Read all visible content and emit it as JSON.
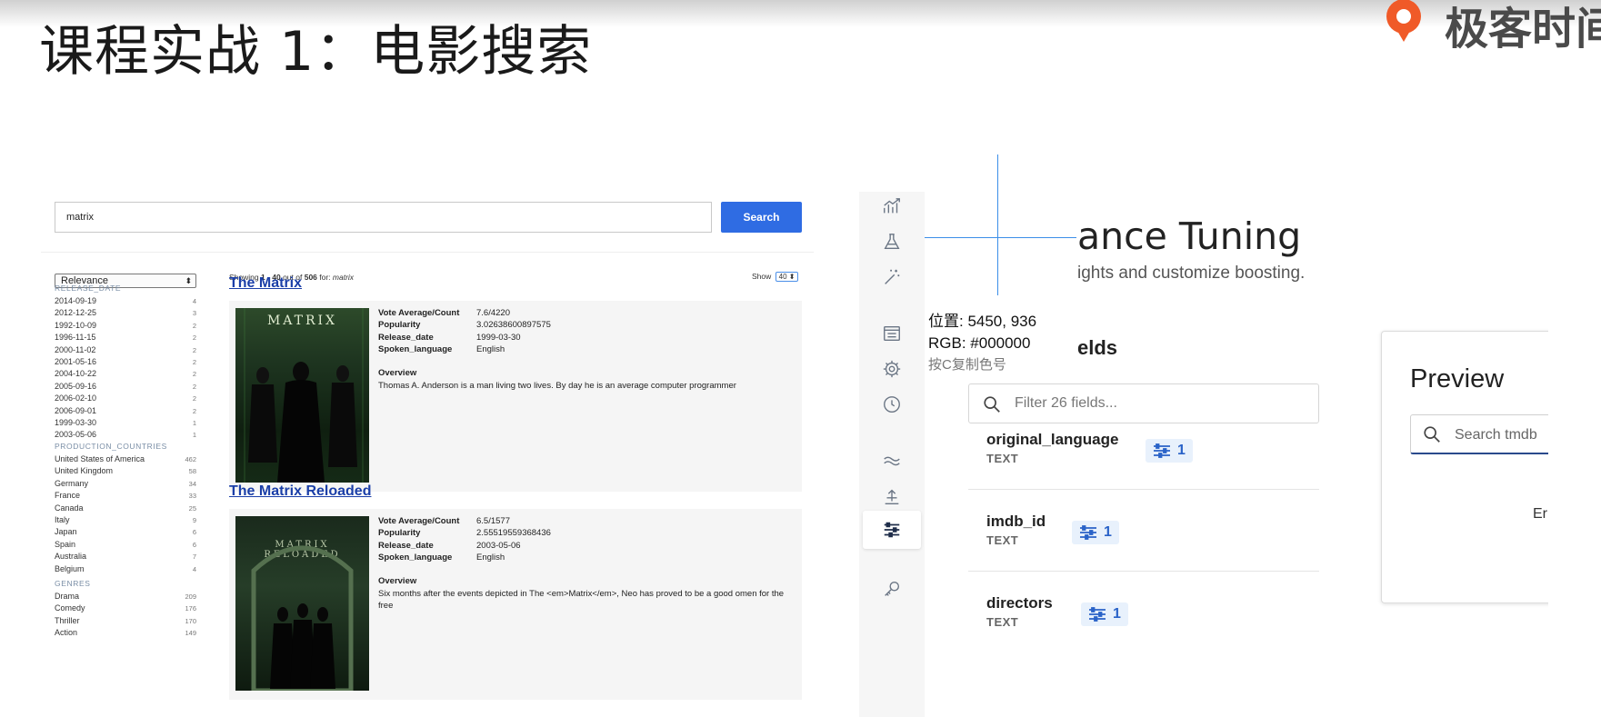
{
  "slide": {
    "title": "课程实战 1：电影搜索",
    "logo_text": "极客时间",
    "logo_color": "#f05a28"
  },
  "search_ui": {
    "query": "matrix",
    "search_label": "Search",
    "search_color": "#2f6ce3",
    "sort": "Relevance",
    "showing": {
      "prefix": "Showing ",
      "range": "1 - 40",
      "mid": " out of ",
      "total": "506",
      "suffix": " for: ",
      "term": "matrix"
    },
    "show_label": "Show",
    "show_value": "40",
    "facets": [
      {
        "title": "RELEASE_DATE",
        "items": [
          {
            "label": "2014-09-19",
            "count": "4"
          },
          {
            "label": "2012-12-25",
            "count": "3"
          },
          {
            "label": "1992-10-09",
            "count": "2"
          },
          {
            "label": "1996-11-15",
            "count": "2"
          },
          {
            "label": "2000-11-02",
            "count": "2"
          },
          {
            "label": "2001-05-16",
            "count": "2"
          },
          {
            "label": "2004-10-22",
            "count": "2"
          },
          {
            "label": "2005-09-16",
            "count": "2"
          },
          {
            "label": "2006-02-10",
            "count": "2"
          },
          {
            "label": "2006-09-01",
            "count": "2"
          },
          {
            "label": "1999-03-30",
            "count": "1"
          },
          {
            "label": "2003-05-06",
            "count": "1"
          }
        ]
      },
      {
        "title": "PRODUCTION_COUNTRIES",
        "items": [
          {
            "label": "United States of America",
            "count": "462"
          },
          {
            "label": "United Kingdom",
            "count": "58"
          },
          {
            "label": "Germany",
            "count": "34"
          },
          {
            "label": "France",
            "count": "33"
          },
          {
            "label": "Canada",
            "count": "25"
          },
          {
            "label": "Italy",
            "count": "9"
          },
          {
            "label": "Japan",
            "count": "6"
          },
          {
            "label": "Spain",
            "count": "6"
          },
          {
            "label": "Australia",
            "count": "7"
          },
          {
            "label": "Belgium",
            "count": "4"
          }
        ]
      },
      {
        "title": "GENRES",
        "items": [
          {
            "label": "Drama",
            "count": "209"
          },
          {
            "label": "Comedy",
            "count": "176"
          },
          {
            "label": "Thriller",
            "count": "170"
          },
          {
            "label": "Action",
            "count": "149"
          }
        ]
      }
    ],
    "results": [
      {
        "title": "The Matrix",
        "poster_text": "MATRIX",
        "vote_label": "Vote Average/Count",
        "vote": "7.6/4220",
        "popularity_label": "Popularity",
        "popularity": "3.02638600897575",
        "release_label": "Release_date",
        "release": "1999-03-30",
        "language_label": "Spoken_language",
        "language": "English",
        "overview_label": "Overview",
        "overview": "Thomas A. Anderson is a man living two lives. By day he is an average computer programmer"
      },
      {
        "title": "The Matrix Reloaded",
        "poster_text": "MATRIX RELOADED",
        "vote_label": "Vote Average/Count",
        "vote": "6.5/1577",
        "popularity_label": "Popularity",
        "popularity": "2.55519559368436",
        "release_label": "Release_date",
        "release": "2003-05-06",
        "language_label": "Spoken_language",
        "language": "English",
        "overview_label": "Overview",
        "overview": "Six months after the events depicted in The <em>Matrix</em>, Neo has proved to be a good omen for the free"
      }
    ]
  },
  "app_search": {
    "heading": "ance Tuning",
    "subheading": "ights and customize boosting.",
    "fields_heading": "elds",
    "filter_placeholder": "Filter 26 fields...",
    "fields": [
      {
        "name": "original_language",
        "type": "TEXT",
        "weight": "1"
      },
      {
        "name": "imdb_id",
        "type": "TEXT",
        "weight": "1"
      },
      {
        "name": "directors",
        "type": "TEXT",
        "weight": "1"
      }
    ],
    "preview_title": "Preview",
    "preview_placeholder": "Search tmdb",
    "preview_partial": "Er",
    "accent_color": "#2a63c8",
    "rail_icons": [
      "analytics-icon",
      "flask-icon",
      "magic-wand-icon",
      "documents-icon",
      "gear-icon",
      "clock-icon",
      "synonyms-icon",
      "curations-icon",
      "relevance-tuning-icon",
      "key-icon"
    ]
  },
  "color_picker": {
    "position_label": "位置: 5450, 936",
    "rgb_label": "RGB: #000000",
    "hint": "按C复制色号",
    "crosshair_color": "#3b8ee8"
  }
}
